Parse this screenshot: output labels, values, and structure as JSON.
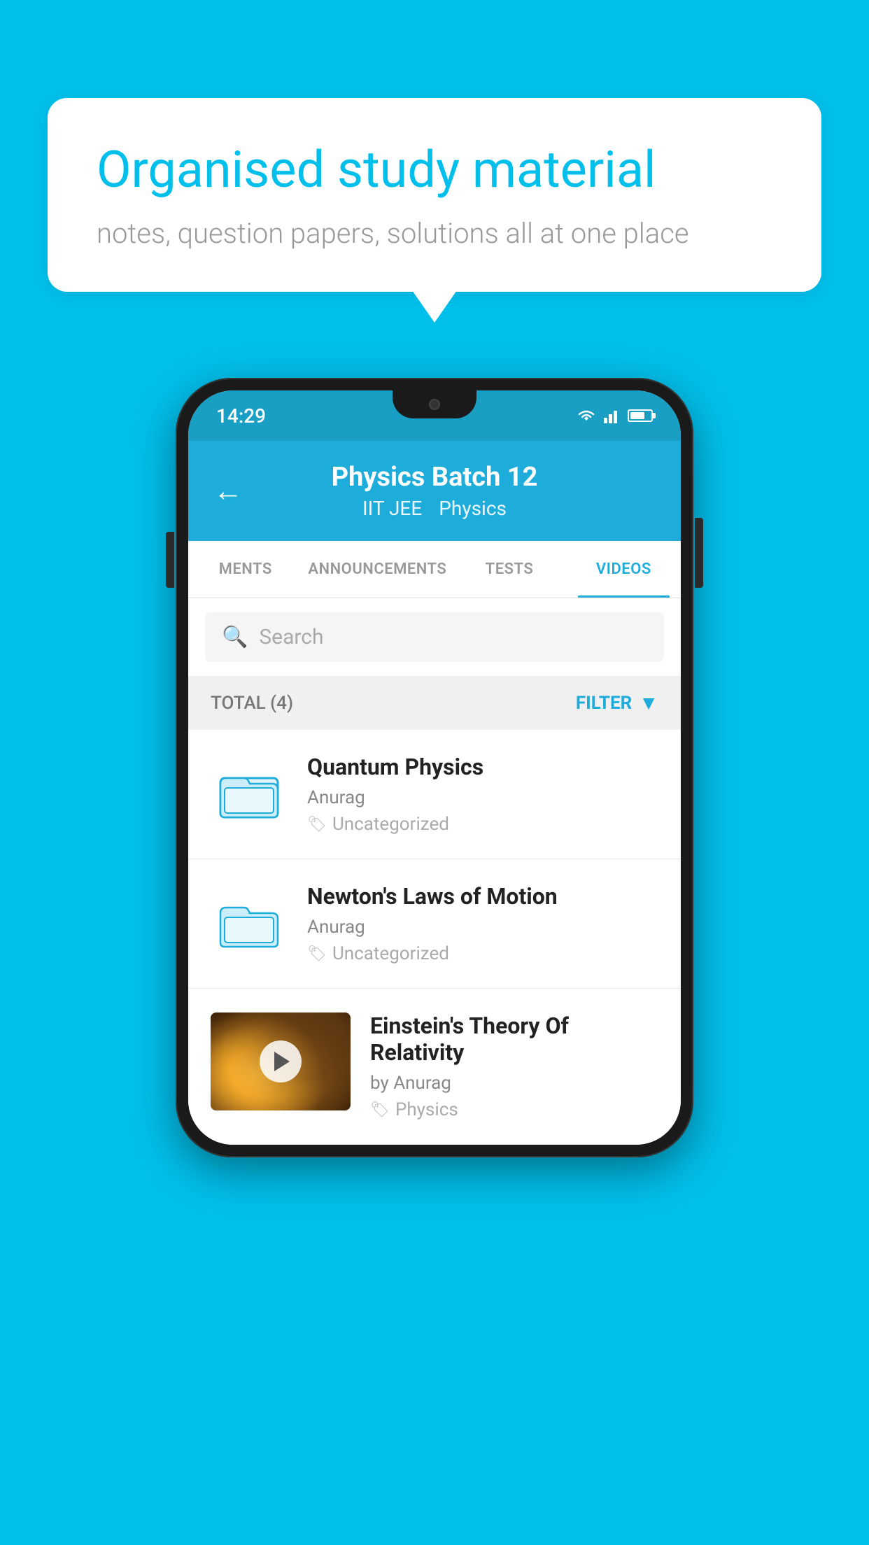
{
  "background_color": "#00BFEA",
  "speech_bubble": {
    "title": "Organised study material",
    "subtitle": "notes, question papers, solutions all at one place"
  },
  "status_bar": {
    "time": "14:29"
  },
  "app_header": {
    "title": "Physics Batch 12",
    "subtitle_left": "IIT JEE",
    "subtitle_right": "Physics",
    "back_icon": "←"
  },
  "tabs": [
    {
      "label": "MENTS",
      "active": false
    },
    {
      "label": "ANNOUNCEMENTS",
      "active": false
    },
    {
      "label": "TESTS",
      "active": false
    },
    {
      "label": "VIDEOS",
      "active": true
    }
  ],
  "search": {
    "placeholder": "Search"
  },
  "filter_bar": {
    "total_label": "TOTAL (4)",
    "filter_label": "FILTER"
  },
  "videos": [
    {
      "title": "Quantum Physics",
      "author": "Anurag",
      "tag": "Uncategorized",
      "has_thumb": false
    },
    {
      "title": "Newton's Laws of Motion",
      "author": "Anurag",
      "tag": "Uncategorized",
      "has_thumb": false
    },
    {
      "title": "Einstein's Theory Of Relativity",
      "author": "by Anurag",
      "tag": "Physics",
      "has_thumb": true
    }
  ]
}
